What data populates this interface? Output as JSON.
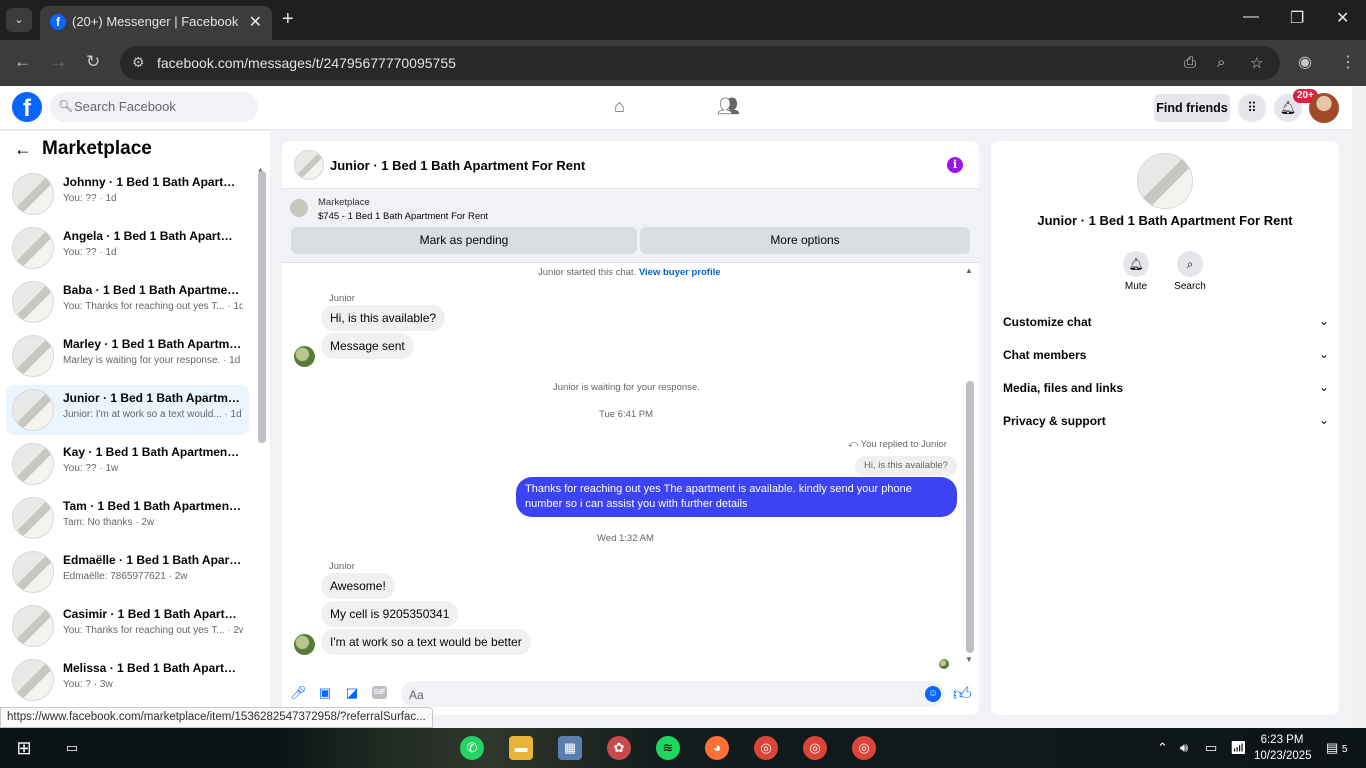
{
  "browser": {
    "tab_title": "(20+) Messenger | Facebook",
    "url": "facebook.com/messages/t/24795677770095755",
    "status_url": "https://www.facebook.com/marketplace/item/1536282547372958/?referralSurfac..."
  },
  "header": {
    "search_placeholder": "Search Facebook",
    "find_friends": "Find friends",
    "notif_count": "20+"
  },
  "sidebar": {
    "title": "Marketplace",
    "conversations": [
      {
        "name": "Johnny · 1 Bed 1 Bath Apartmen...",
        "preview": "You: ?? · 1d"
      },
      {
        "name": "Angela · 1 Bed 1 Bath Apartmen...",
        "preview": "You: ?? · 1d"
      },
      {
        "name": "Baba · 1 Bed 1 Bath Apartment ...",
        "preview": "You: Thanks for reaching out yes T... · 1d"
      },
      {
        "name": "Marley · 1 Bed 1 Bath Apartmen...",
        "preview": "Marley is waiting for your response. · 1d"
      },
      {
        "name": "Junior · 1 Bed 1 Bath Apartment...",
        "preview": "Junior: I'm at work so a text would... · 1d"
      },
      {
        "name": "Kay · 1 Bed 1 Bath Apartment F...",
        "preview": "You: ?? · 1w"
      },
      {
        "name": "Tam · 1 Bed 1 Bath Apartment F...",
        "preview": "Tam: No thanks · 2w"
      },
      {
        "name": "Edmaëlle · 1 Bed 1 Bath Apartm...",
        "preview": "Edmaëlle: 7865977621 · 2w"
      },
      {
        "name": "Casimir · 1 Bed 1 Bath Apartme...",
        "preview": "You: Thanks for reaching out yes T... · 2w"
      },
      {
        "name": "Melissa · 1 Bed 1 Bath Apartme...",
        "preview": "You: ? · 3w"
      }
    ]
  },
  "chat": {
    "title": "Junior · 1 Bed 1 Bath Apartment For Rent",
    "marketplace_label": "Marketplace",
    "listing": "$745 - 1 Bed 1 Bath Apartment For Rent",
    "mark_pending": "Mark as pending",
    "more_options": "More options",
    "started_text": "Junior started this chat.",
    "view_profile": "View buyer profile",
    "sender_1": "Junior",
    "msg_1": "Hi, is this available?",
    "msg_2": "Message sent",
    "waiting": "Junior is waiting for your response.",
    "time_1": "Tue 6:41 PM",
    "replied_note": "You replied to Junior",
    "quoted": "Hi, is this available?",
    "reply": "Thanks for reaching out yes The apartment is available. kindly send your phone number so i can assist you with further details",
    "time_2": "Wed 1:32 AM",
    "sender_2": "Junior",
    "msg_3": "Awesome!",
    "msg_4": "My cell is 9205350341",
    "msg_5": "I'm at work so a text would be better",
    "composer_placeholder": "Aa"
  },
  "details": {
    "title": "Junior · 1 Bed 1 Bath Apartment For Rent",
    "mute": "Mute",
    "search": "Search",
    "sections": [
      "Customize chat",
      "Chat members",
      "Media, files and links",
      "Privacy & support"
    ]
  },
  "taskbar": {
    "time": "6:23 PM",
    "date": "10/23/2025",
    "notif": "5"
  }
}
